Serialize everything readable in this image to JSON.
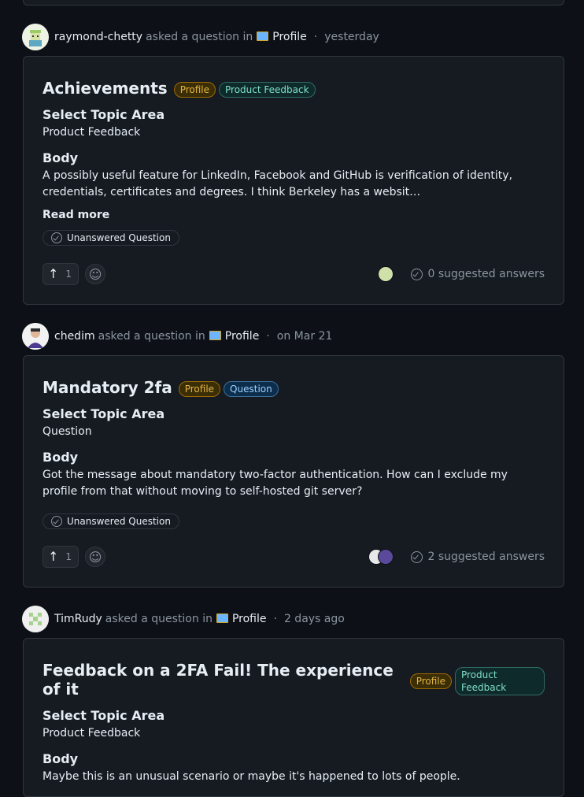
{
  "discussions": [
    {
      "author": "raymond-chetty",
      "asked_text": "asked a question in",
      "category": "Profile",
      "time": "yesterday",
      "title": "Achievements",
      "labels": [
        "Profile",
        "Product Feedback"
      ],
      "topic_heading": "Select Topic Area",
      "topic_value": "Product Feedback",
      "body_heading": "Body",
      "body_text": "A possibly useful feature for LinkedIn, Facebook and GitHub is verification of identity, credentials, certificates and degrees. I think Berkeley has a websit…",
      "read_more": "Read more",
      "status": "Unanswered Question",
      "upvotes": "1",
      "answers": "0 suggested answers"
    },
    {
      "author": "chedim",
      "asked_text": "asked a question in",
      "category": "Profile",
      "time": "on Mar 21",
      "title": "Mandatory 2fa",
      "labels": [
        "Profile",
        "Question"
      ],
      "topic_heading": "Select Topic Area",
      "topic_value": "Question",
      "body_heading": "Body",
      "body_text": "Got the message about mandatory two-factor authentication. How can I exclude my profile from that without moving to self-hosted git server?",
      "status": "Unanswered Question",
      "upvotes": "1",
      "answers": "2 suggested answers"
    },
    {
      "author": "TimRudy",
      "asked_text": "asked a question in",
      "category": "Profile",
      "time": "2 days ago",
      "title": "Feedback on a 2FA Fail! The experience of it",
      "labels": [
        "Profile",
        "Product Feedback"
      ],
      "topic_heading": "Select Topic Area",
      "topic_value": "Product Feedback",
      "body_heading": "Body",
      "body_text": "Maybe this is an unusual scenario or maybe it's happened to lots of people."
    }
  ],
  "icons": {
    "upvote": "arrow-up-icon",
    "react": "smiley-icon",
    "status": "check-circle-icon",
    "category": "picture-icon"
  },
  "colors": {
    "background": "#0d1117",
    "card": "#161b22",
    "border": "#30363d",
    "muted": "#8b949e",
    "label_profile": "#e3b341",
    "label_feedback": "#7ee0c6",
    "label_question": "#9fd1ff"
  }
}
